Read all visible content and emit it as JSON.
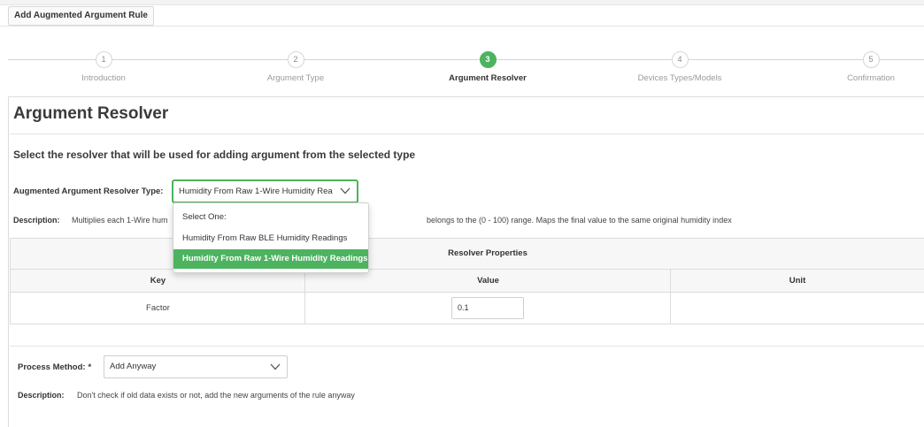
{
  "header": {
    "title": "Add Augmented Argument Rule"
  },
  "wizard": {
    "steps": [
      {
        "number": "1",
        "label": "Introduction"
      },
      {
        "number": "2",
        "label": "Argument Type"
      },
      {
        "number": "3",
        "label": "Argument Resolver"
      },
      {
        "number": "4",
        "label": "Devices Types/Models"
      },
      {
        "number": "5",
        "label": "Confirmation"
      }
    ],
    "active_step": 3
  },
  "main": {
    "section_title": "Argument Resolver",
    "instruction": "Select the resolver that will be used for adding argument from the selected type",
    "resolver": {
      "label": "Augmented Argument Resolver Type:",
      "selected_value": "Humidity From Raw 1-Wire Humidity Rea",
      "description_label": "Description:",
      "description_left": "Multiplies each 1-Wire hum",
      "description_right": "belongs to the (0 - 100) range. Maps the final value to the same original humidity index",
      "options": [
        "Select One:",
        "Humidity From Raw BLE Humidity Readings",
        "Humidity From Raw 1-Wire Humidity Readings"
      ],
      "highlighted_option": 2
    },
    "properties_table": {
      "title": "Resolver Properties",
      "columns": [
        "Key",
        "Value",
        "Unit"
      ],
      "rows": [
        {
          "key": "Factor",
          "value": "0.1",
          "unit": ""
        }
      ]
    },
    "process_method": {
      "label": "Process Method:",
      "required_mark": "*",
      "selected_value": "Add Anyway",
      "description_label": "Description:",
      "description": "Don't check if old data exists or not, add the new arguments of the rule anyway"
    }
  },
  "colors": {
    "accent": "#4db35f",
    "border": "#dcdcdc"
  }
}
